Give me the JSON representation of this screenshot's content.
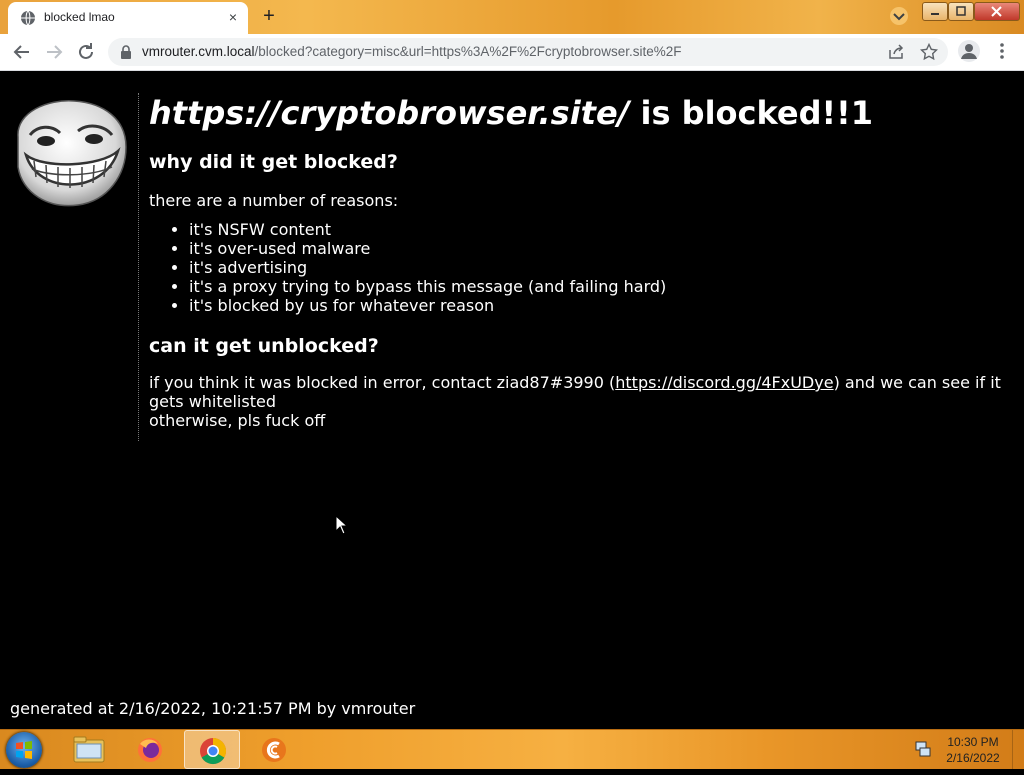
{
  "browser": {
    "tab_title": "blocked lmao",
    "tab_close": "×",
    "new_tab": "+",
    "url_host": "vmrouter.cvm.local",
    "url_rest": "/blocked?category=misc&url=https%3A%2F%2Fcryptobrowser.site%2F"
  },
  "page": {
    "blocked_url": "https://cryptobrowser.site/",
    "headline_suffix": " is blocked!!1",
    "why_heading": "why did it get blocked?",
    "reasons_intro": "there are a number of reasons:",
    "reasons": [
      "it's NSFW content",
      "it's over-used malware",
      "it's advertising",
      "it's a proxy trying to bypass this message (and failing hard)",
      "it's blocked by us for whatever reason"
    ],
    "unblock_heading": "can it get unblocked?",
    "unblock_text_before": "if you think it was blocked in error, contact ziad87#3990 (",
    "unblock_link": "https://discord.gg/4FxUDye",
    "unblock_text_after": ") and we can see if it gets whitelisted",
    "unblock_text_line2": "otherwise, pls fuck off",
    "footer": "generated at 2/16/2022, 10:21:57 PM by vmrouter"
  },
  "taskbar": {
    "items": [
      "file-explorer-icon",
      "firefox-icon",
      "chrome-icon",
      "ccleaner-icon"
    ],
    "active_item": "chrome-icon",
    "clock_time": "10:30 PM",
    "clock_date": "2/16/2022"
  },
  "colors": {
    "page_bg": "#000000",
    "page_text": "#ffffff",
    "taskbar": "#ef9f2c"
  }
}
